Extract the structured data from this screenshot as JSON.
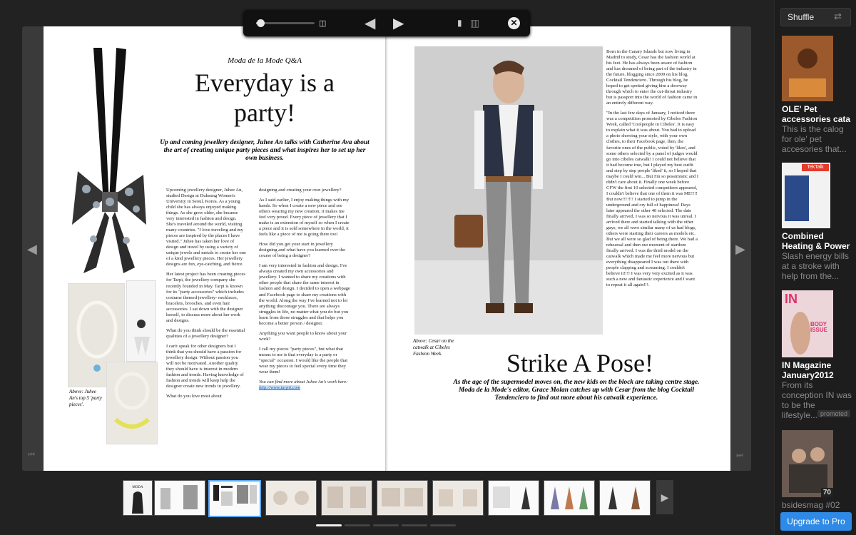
{
  "toolbar": {
    "progress": 0.07,
    "icons": [
      "two-page-view-icon",
      "previous-page-icon",
      "next-page-icon",
      "single-page-icon",
      "spread-page-icon",
      "close-icon"
    ]
  },
  "left_page": {
    "kicker": "Moda de la Mode Q&A",
    "title": "Everyday is a party!",
    "intro": "Up and coming jewellery designer, Juhee An talks with Catherine Ava about the art of creating unique party pieces and what inspires her to set up her own business.",
    "col1": [
      "Upcoming jewellery designer, Juhee An, studied Design at Duksung Women's University in Seoul, Korea. As a young child she has always enjoyed making things. As she grew older, she became very interested in fashion and design. She's traveled around the world, visiting many countries. \"I love traveling and my pieces are inspired by the places I have visited.\" Juhee has taken her love of design and travel by using a variety of unique jewels and metals to create her one of a kind jewellery pieces. Her jewellery designs are fun, eye-catching, and fierce.",
      "Her latest project has been creating pieces for Tarpi, the jewellery company she recently founded in May. Tarpi is known for its \"party accessories\" which includes costume themed jewellery- necklaces, bracelets, brooches, and even hair accessories. I sat down with the designer herself, to discuss more about her work and designs.",
      "What do you think should be the essential qualities of a jewellery designer?",
      "I can't speak for other designers but I think that you should have a passion for jewellery design. Without passion you will not be motivated. Another quality they should have is interest in modern fashion and trends. Having knowledge of fashion and trends will keep help the designer create new trends in jewellery.",
      "What do you love most about"
    ],
    "col2": [
      "designing and creating your own jewellery?",
      "As I said earlier, I enjoy making things with my hands. So when I create a new piece and see others wearing my new creation, it makes me feel very proud. Every piece of jewellery that I make is an extension of myself so when I create a piece and it is sold somewhere in the world, it feels like a piece of me is going there too!",
      "How did you get your start in jewellery designing and what have you learned over the course of being a designer?",
      "I am very interested in fashion and design. I've always created my own accessories and jewellery. I wanted to share my creations with other people that share the same interest in fashion and design. I decided to open a webpage and Facebook page to share my creations with the world. Along the way I've learned not to let anything discourage you. There are always struggles in life, no matter what you do but you learn from those struggles and that helps you become a better person / designer.",
      "Anything you want people to know about your work?",
      "I call my pieces \"party pieces\", but what that means to me is that everyday is a party or \"special\" occasion. I would like the people that wear my pieces to feel special every time they wear them!"
    ],
    "footer_text": "You can find more about Juhee An's work here:",
    "footer_link": "http://www.tarpii.com",
    "caption": "Above: Juhee An's top 5 'party pieces'."
  },
  "right_page": {
    "caption": "Above: Cesar on the catwalk at Cibeles Fashion Week.",
    "title": "Strike A Pose!",
    "intro": "As the age of the supermodel moves on, the new kids on the block are taking centre stage. Moda de la Mode's editor, Grace Molan catches up with Cesar from the blog Cocktail Tendenciero to find out more about his catwalk experience.",
    "col": [
      "Born in the Canary Islands but now living in Madrid to study, Cesar has the fashion world at his feet. He has always been aware of fashion and has dreamed of being part of the industry in the future, blogging since 2009 on his blog, Cocktail Tendenciero. Through his blog, he hoped to get spotted giving him a doorway through which to enter the cut-throat industry but is passport into the world of fashion came in an entirely different way.",
      "\"In the last few days of January, I noticed there was a competition promoted by Cibeles Fashion Week, called 'Coolpeople in Cibeles'. It is easy to explain what it was about. You had to upload a photo showing your style, with your own clothes, to their Facebook page, then, the favorite ones of the public, voted by 'likes', and some others selected by a panel of judges would go into cibeles catwalk! I could not believe that it had become true, but I played my best outfit and step by step people 'liked' it, so I hoped that maybe I could win... But I'm so pessimistic and I didn't care about it. Finally one week before CFW the first 10 selected competitors appeared, I couldn't believe that one of them it was ME!!!! But now!!!!!!! I started to jump in the underground and cry full of happiness! Days later appeared the other 40 selected. The date finally arrived, I was so nervous it was unreal. I arrived there and started talking with the other guys, we all were similar many of us had blogs, others were starting their careers as models etc. But we all were so glad of being there. We had a rehearsal and then our moment of stardom finally arrived. I was the third model on the catwalk which made me feel more nervous but everything disappeared I was out there with people clapping and screaming. I couldn't believe it!!!! I was very very excited as it was such a new and fantastic experience and I want to repeat it all again!!!."
    ]
  },
  "thumbnails": [
    "page-1-2",
    "page-3-4",
    "page-5-6",
    "page-7-8",
    "page-9-10",
    "page-11-12",
    "page-13-14",
    "page-15-16",
    "page-17-18",
    "page-19-20"
  ],
  "selected_thumbnail": 2,
  "thumb_pager": {
    "pages": 5,
    "active": 0
  },
  "sidebar": {
    "shuffle_label": "Shuffle",
    "items": [
      {
        "title": "OLE' Pet accessories cata",
        "desc": "This is the calog for ole' pet accesories that..."
      },
      {
        "title": "Combined Heating & Power",
        "desc": "Slash energy bills at a stroke with help from the...",
        "thumb_label": "TekTalk"
      },
      {
        "title": "IN Magazine January2012",
        "desc": "From its conception IN was to be the lifestyle...",
        "badge": "promoted",
        "thumb_label": "BODY ISSUE"
      },
      {
        "title": "bsidesmag #02",
        "count": "70"
      }
    ],
    "upgrade_label": "Upgrade to Pro"
  },
  "colors": {
    "accent": "#2e8ae6",
    "background": "#222222",
    "sidebar": "#1d1d1d"
  }
}
